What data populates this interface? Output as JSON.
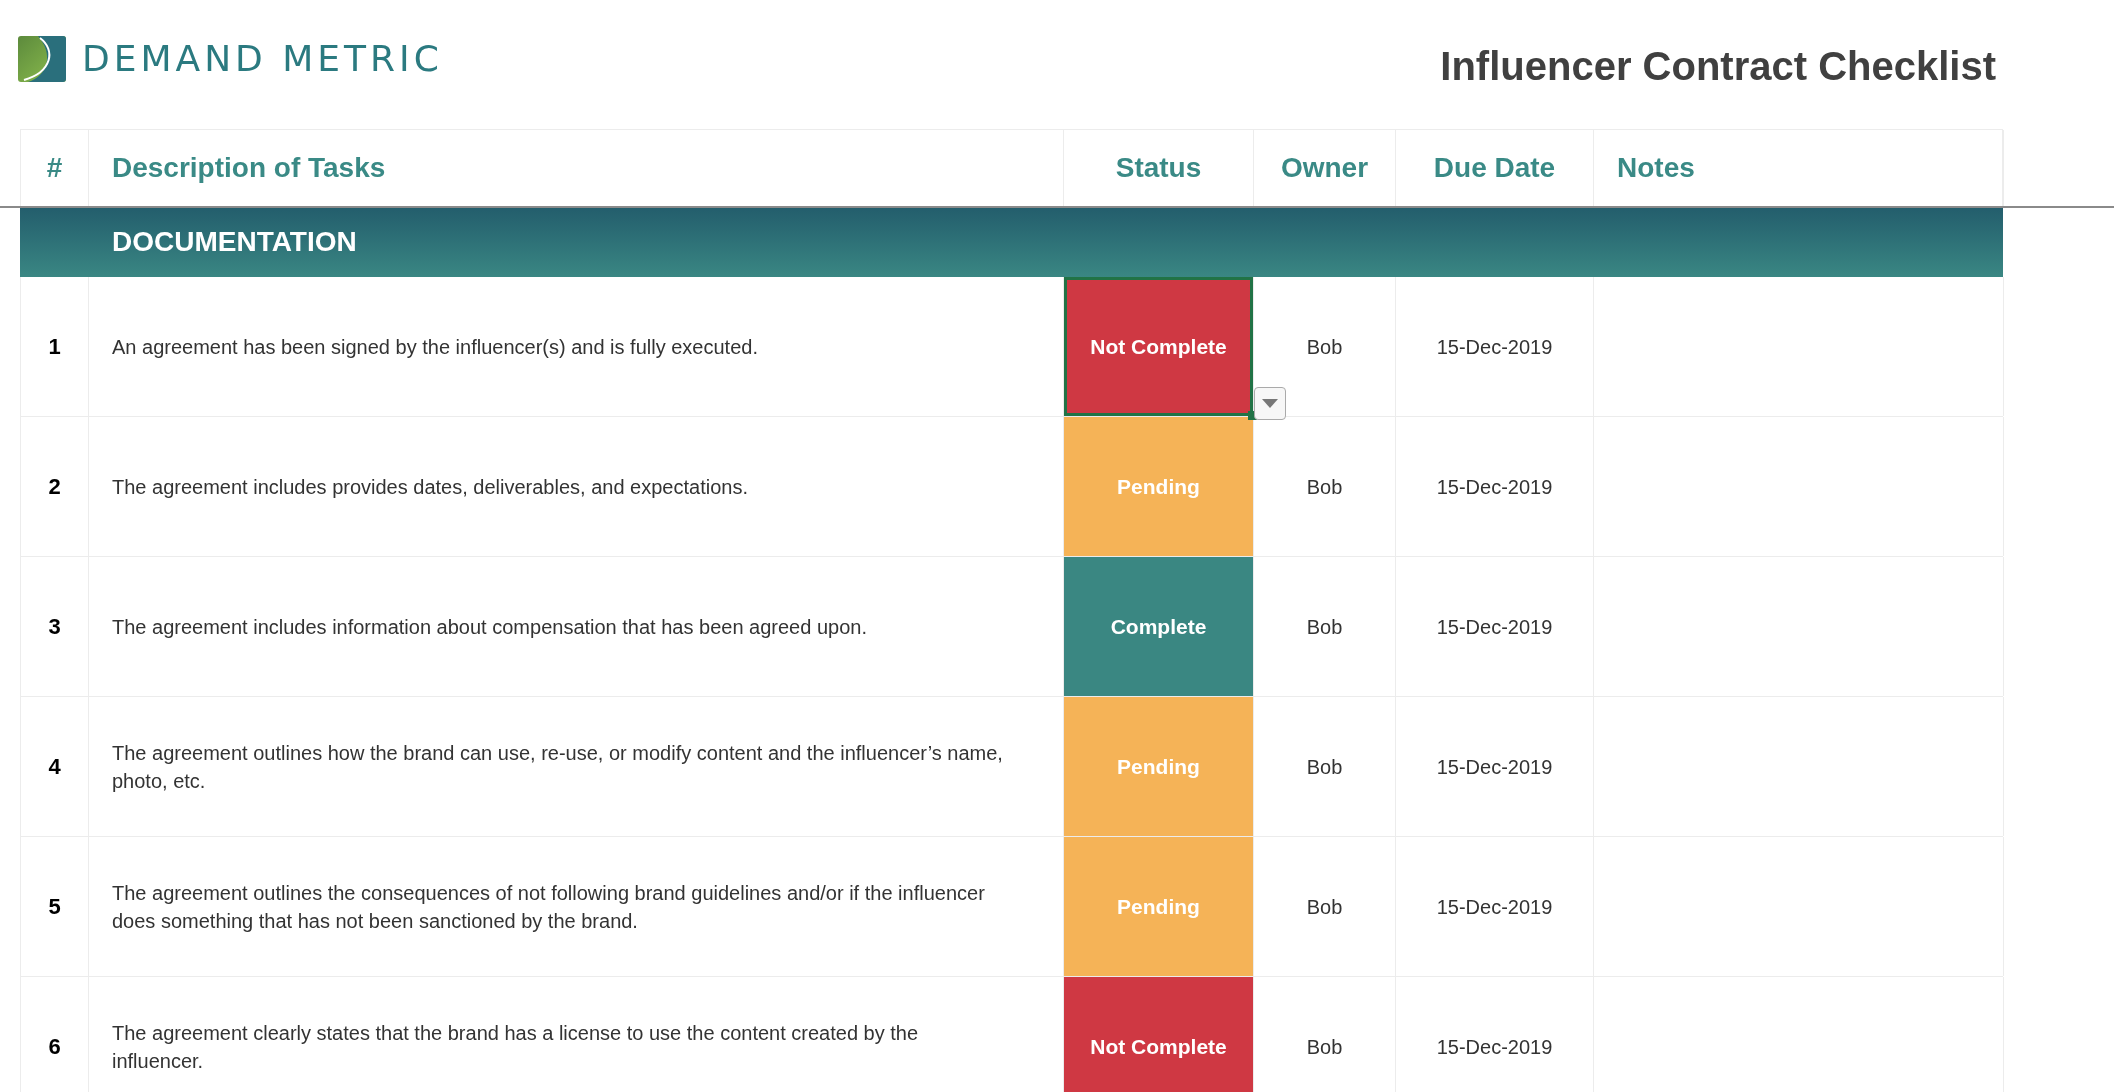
{
  "logo": {
    "text": "DEMAND METRIC"
  },
  "title": "Influencer Contract Checklist",
  "table": {
    "columns": [
      "#",
      "Description of Tasks",
      "Status",
      "Owner",
      "Due Date",
      "Notes"
    ],
    "section": "DOCUMENTATION",
    "rows": [
      {
        "number": "1",
        "description": "An agreement has been signed by the influencer(s) and is fully executed.",
        "status": {
          "text": "Not Complete",
          "kind": "not_complete",
          "selected": true
        },
        "owner": "Bob",
        "due_date": "15-Dec-2019"
      },
      {
        "number": "2",
        "description": "The agreement includes provides dates, deliverables, and expectations.",
        "status": {
          "text": "Pending",
          "kind": "pending",
          "selected": false
        },
        "owner": "Bob",
        "due_date": "15-Dec-2019"
      },
      {
        "number": "3",
        "description": "The agreement includes information about compensation that has been agreed upon.",
        "status": {
          "text": "Complete",
          "kind": "complete",
          "selected": false
        },
        "owner": "Bob",
        "due_date": "15-Dec-2019"
      },
      {
        "number": "4",
        "description": "The agreement outlines how the brand can use, re-use, or modify content and the influencer’s name, photo, etc.",
        "status": {
          "text": "Pending",
          "kind": "pending",
          "selected": false
        },
        "owner": "Bob",
        "due_date": "15-Dec-2019"
      },
      {
        "number": "5",
        "description": "The agreement outlines the consequences of not following brand guidelines and/or if the influencer does something that has not been sanctioned by the brand.",
        "status": {
          "text": "Pending",
          "kind": "pending",
          "selected": false
        },
        "owner": "Bob",
        "due_date": "15-Dec-2019"
      },
      {
        "number": "6",
        "description": "The agreement clearly states that the brand has a license to use the content created by the influencer.",
        "status": {
          "text": "Not Complete",
          "kind": "not_complete",
          "selected": false
        },
        "owner": "Bob",
        "due_date": "15-Dec-2019"
      }
    ]
  }
}
